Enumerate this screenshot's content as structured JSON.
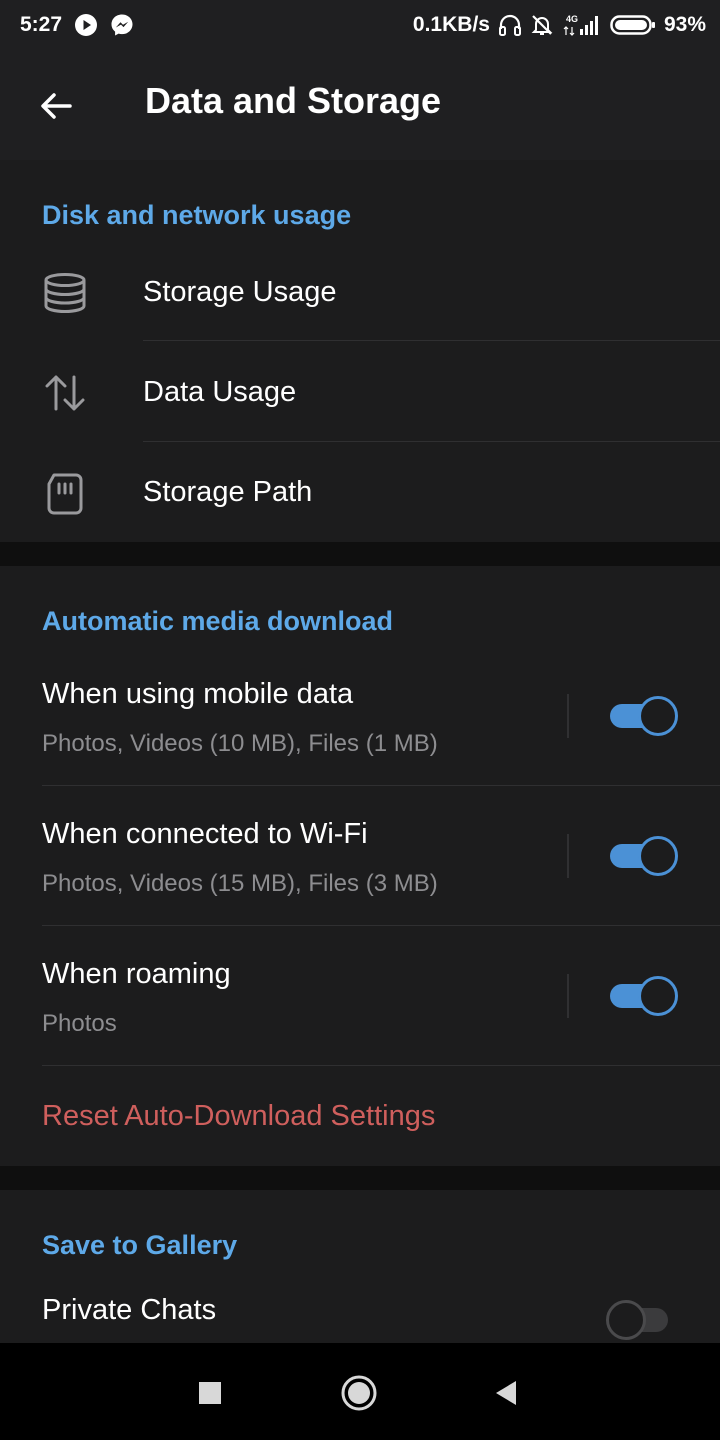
{
  "status_bar": {
    "time": "5:27",
    "net_speed": "0.1KB/s",
    "network_type": "4G",
    "battery": "93%",
    "icons": [
      "play-icon",
      "messenger-icon",
      "headphones-icon",
      "bell-off-icon",
      "signal-icon",
      "battery-icon"
    ]
  },
  "header": {
    "title": "Data and Storage",
    "back_icon": "arrow-left-icon"
  },
  "disk_section": {
    "title": "Disk and network usage",
    "items": [
      {
        "label": "Storage Usage",
        "icon": "database-icon"
      },
      {
        "label": "Data Usage",
        "icon": "up-down-arrows-icon"
      },
      {
        "label": "Storage Path",
        "icon": "sd-card-icon"
      }
    ]
  },
  "media_section": {
    "title": "Automatic media download",
    "items": [
      {
        "title": "When using mobile data",
        "subtitle": "Photos, Videos (10 MB), Files (1 MB)",
        "enabled": true
      },
      {
        "title": "When connected to Wi-Fi",
        "subtitle": "Photos, Videos (15 MB), Files (3 MB)",
        "enabled": true
      },
      {
        "title": "When roaming",
        "subtitle": "Photos",
        "enabled": true
      }
    ],
    "reset_label": "Reset Auto-Download Settings"
  },
  "gallery_section": {
    "title": "Save to Gallery",
    "items": [
      {
        "title": "Private Chats",
        "enabled": false
      }
    ]
  },
  "nav_bar": {
    "buttons": [
      "recents-square-icon",
      "home-circle-icon",
      "back-triangle-icon"
    ]
  },
  "colors": {
    "accent": "#5ea9e8",
    "toggle_on": "#4b91d6",
    "danger": "#cf5f5d",
    "background": "#1c1c1d",
    "header": "#1f1f21"
  }
}
